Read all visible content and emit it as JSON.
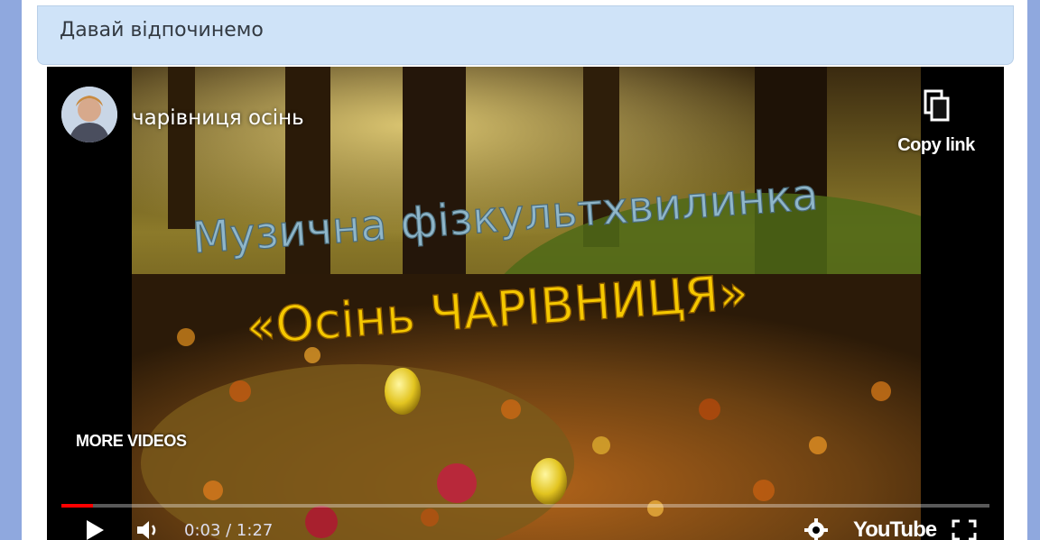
{
  "card": {
    "title": "Давай відпочинемо"
  },
  "video": {
    "channel_name": "чарівниця осінь",
    "title_line1": "Музична фізкультхвилинка",
    "title_line2": "«Осінь ЧАРІВНИЦЯ»",
    "copy_link_label": "Copy link",
    "more_videos_label": "MORE VIDEOS",
    "time_current": "0:03",
    "time_total": "1:27",
    "time_display": "0:03 / 1:27",
    "progress_fraction": 0.034,
    "youtube_logo_text": "YouTube",
    "icons": [
      "copy-icon",
      "play-icon",
      "volume-icon",
      "settings-icon",
      "fullscreen-icon"
    ]
  },
  "colors": {
    "accent_progress": "#ff0000",
    "side_bars": "#8fa8de",
    "header_bg": "#cfe3f8",
    "title_line1": "#8fb6c9",
    "title_line2": "#f5c800"
  }
}
